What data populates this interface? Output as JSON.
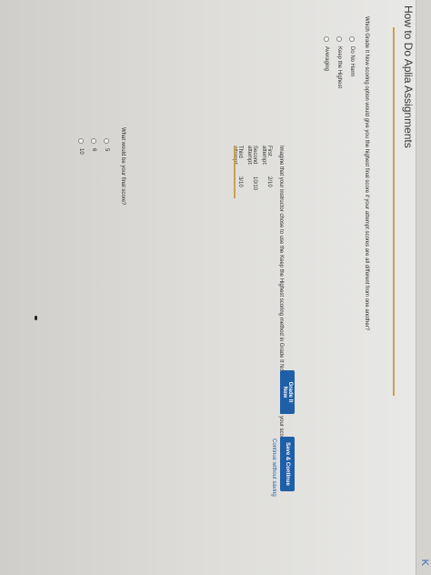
{
  "header": {
    "title": "How to Do Aplia Assignments",
    "corner_mark": "K"
  },
  "question1": {
    "text": "Which Grade It Now scoring option would give you the highest final score if your attempt scores are all different from one another?",
    "options": [
      "Do No Harm",
      "Keep the Highest",
      "Averaging"
    ]
  },
  "question2": {
    "text": "Imagine that your instructor chose to use the Keep the Highest scoring method in Grade It Now mode. Here are your scores:",
    "scores": [
      {
        "label": "First attempt:",
        "value": "2/10"
      },
      {
        "label": "Second attempt:",
        "value": "10/10"
      },
      {
        "label": "Third attempt:",
        "value": "3/10"
      }
    ]
  },
  "question3": {
    "text": "What would be your final score?",
    "options": [
      "5",
      "6",
      "10"
    ]
  },
  "actions": {
    "grade_label": "Grade It Now",
    "save_label": "Save & Continue",
    "continue_link": "Continue without saving"
  },
  "colors": {
    "button": "#1f5fa8",
    "accent_rule": "#c9a24a"
  }
}
